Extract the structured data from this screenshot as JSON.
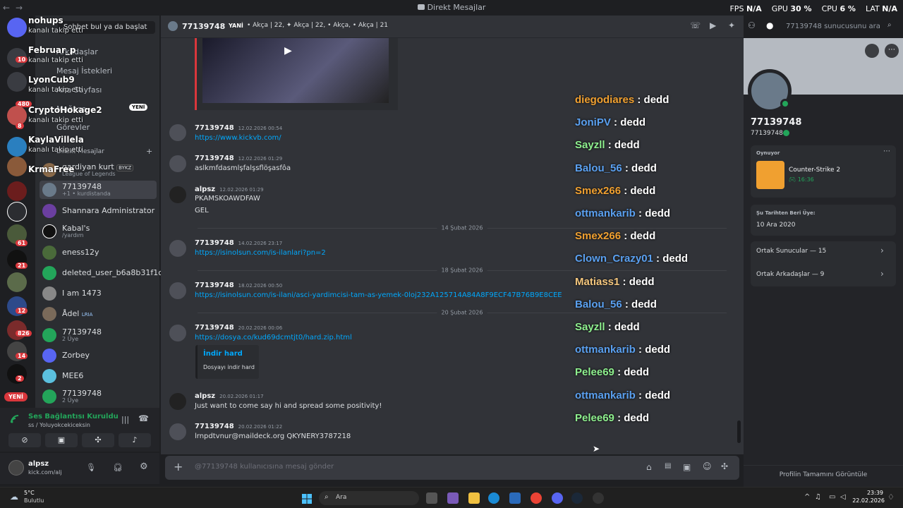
{
  "window": {
    "back": "←",
    "forward": "→",
    "title": "Direkt Mesajlar",
    "perf": [
      {
        "label": "FPS",
        "value": "N/A"
      },
      {
        "label": "GPU",
        "value": "30 %"
      },
      {
        "label": "CPU",
        "value": "6 %"
      },
      {
        "label": "LAT",
        "value": "N/A"
      }
    ]
  },
  "rail": {
    "badges": [
      "10",
      "480",
      "8",
      "61",
      "21",
      "12",
      "826",
      "14",
      "2"
    ],
    "new_label": "YENİ"
  },
  "toasts": [
    {
      "name": "nohups",
      "sub": "kanalı takip etti"
    },
    {
      "name": "Februar_p",
      "sub": "kanalı takip etti"
    },
    {
      "name": "LyonCub9",
      "sub": "kanalı takip etti"
    },
    {
      "name": "CryptoHokage2",
      "sub": "kanalı takip etti"
    },
    {
      "name": "KaylaVillela",
      "sub": "kanalı takip etti"
    },
    {
      "name": "KrmaFree",
      "sub": ""
    }
  ],
  "dm_sidebar": {
    "search_label": "Sohbet bul ya da başlat",
    "nav": [
      "Arkadaşlar",
      "Mesaj İstekleri",
      "Ana Sayfası",
      "Mağaza",
      "Görevler"
    ],
    "new_tag": "YENİ",
    "section": "Direkt Mesajlar",
    "add": "+",
    "rows": [
      {
        "name": "gardiyan kurt",
        "tag": "BYKZ",
        "sub": "League of Legends"
      },
      {
        "name": "77139748",
        "sub": "+1 • kurdistanda"
      },
      {
        "name": "Shannara Administrator",
        "sub": ""
      },
      {
        "name": "Kabal's",
        "sub": "/yardım"
      },
      {
        "name": "eness12y",
        "sub": ""
      },
      {
        "name": "deleted_user_b6a8b31f1c...",
        "sub": ""
      },
      {
        "name": "I am 1473",
        "sub": ""
      },
      {
        "name": "Ådel",
        "tag": "LRIA",
        "sub": ""
      },
      {
        "name": "77139748",
        "sub": "2 Üye"
      },
      {
        "name": "Zorbey",
        "sub": ""
      },
      {
        "name": "MEE6",
        "sub": ""
      },
      {
        "name": "77139748",
        "sub": "2 Üye"
      }
    ]
  },
  "voice": {
    "status": "Ses Bağlantısı Kuruldu",
    "channel": "ss / Yoluyokcekiceksin"
  },
  "user": {
    "name": "alpsz",
    "status": "kick.com/alj"
  },
  "header": {
    "channel": "77139748",
    "new_tag": "YANİ",
    "tags": "• Akça | 22, ✦ Akça | 22, • Akça,  • Akça | 21",
    "search_placeholder": "77139748 sunucusunu ara"
  },
  "messages": [
    {
      "author": "77139748",
      "time": "12.02.2026 00:54",
      "lines": [],
      "link": "https://www.kickvb.com/"
    },
    {
      "author": "77139748",
      "time": "12.02.2026 01:29",
      "lines": [
        "aslkmfdasmlşfalşsflöşasfôa"
      ],
      "link": ""
    },
    {
      "author": "alpsz",
      "time": "12.02.2026 01:29",
      "lines": [
        "PKAMSKOAWDFAW",
        "GEL"
      ],
      "link": ""
    },
    {
      "author": "77139748",
      "time": "14.02.2026 23:17",
      "lines": [],
      "link": "https://isinolsun.com/is-ilanlari?pn=2"
    },
    {
      "author": "77139748",
      "time": "18.02.2026 00:50",
      "lines": [],
      "link": "https://isinolsun.com/is-ilani/asci-yardimcisi-tam-as-yemek-0loj232A125714A84A8F9ECF47B76B9E8CEE"
    },
    {
      "author": "77139748",
      "time": "20.02.2026 00:06",
      "lines": [],
      "link": "https://dosya.co/kud69dcmtjt0/hard.zip.html"
    },
    {
      "author": "alpsz",
      "time": "20.02.2026 01:17",
      "lines": [
        "Just want to come say hi and spread some positivity!"
      ],
      "link": ""
    },
    {
      "author": "77139748",
      "time": "20.02.2026 01:22",
      "lines": [
        "lrnpdtvnur@maildeck.org QKYNERY3787218"
      ],
      "link": ""
    }
  ],
  "dividers": [
    "14 Şubat 2026",
    "18 Şubat 2026",
    "20 Şubat 2026"
  ],
  "embed": {
    "title": "İndir hard",
    "desc": "Dosyayı indir hard"
  },
  "feed": [
    {
      "name": "diegodiares",
      "color": "#f0a030"
    },
    {
      "name": "JoniPV",
      "color": "#5aa0f0"
    },
    {
      "name": "Sayzll",
      "color": "#8ef08e"
    },
    {
      "name": "Balou_56",
      "color": "#5aa0f0"
    },
    {
      "name": "Smex266",
      "color": "#f0a030"
    },
    {
      "name": "ottmankarib",
      "color": "#5aa0f0"
    },
    {
      "name": "Smex266",
      "color": "#f0a030"
    },
    {
      "name": "Clown_Crazy01",
      "color": "#5aa0f0"
    },
    {
      "name": "Matiass1",
      "color": "#f5c77e"
    },
    {
      "name": "Balou_56",
      "color": "#5aa0f0"
    },
    {
      "name": "Sayzll",
      "color": "#8ef08e"
    },
    {
      "name": "ottmankarib",
      "color": "#5aa0f0"
    },
    {
      "name": "Pelee69",
      "color": "#8ef08e"
    },
    {
      "name": "ottmankarib",
      "color": "#5aa0f0"
    },
    {
      "name": "Pelee69",
      "color": "#8ef08e"
    }
  ],
  "feed_tail": ": dedd",
  "composer": {
    "placeholder": "@77139748 kullanıcısına mesaj gönder"
  },
  "profile": {
    "name": "77139748",
    "handle": "77139748",
    "playing_label": "Oynuyor",
    "game": "Counter-Strike 2",
    "game_time": "16:36",
    "member_since_label": "Şu Tarihten Beri Üye:",
    "member_since": "10 Ara 2020",
    "mutual_servers": "Ortak Sunucular — 15",
    "mutual_friends": "Ortak Arkadaşlar — 9",
    "full_profile": "Profilin Tamamını Görüntüle"
  },
  "taskbar": {
    "temp": "5°C",
    "weather": "Bulutlu",
    "search": "Ara",
    "time": "23:39",
    "date": "22.02.2026"
  },
  "colors": {
    "accent": "#5865f2",
    "link": "#00a8fc",
    "online": "#23a55a",
    "badge": "#da373c"
  }
}
